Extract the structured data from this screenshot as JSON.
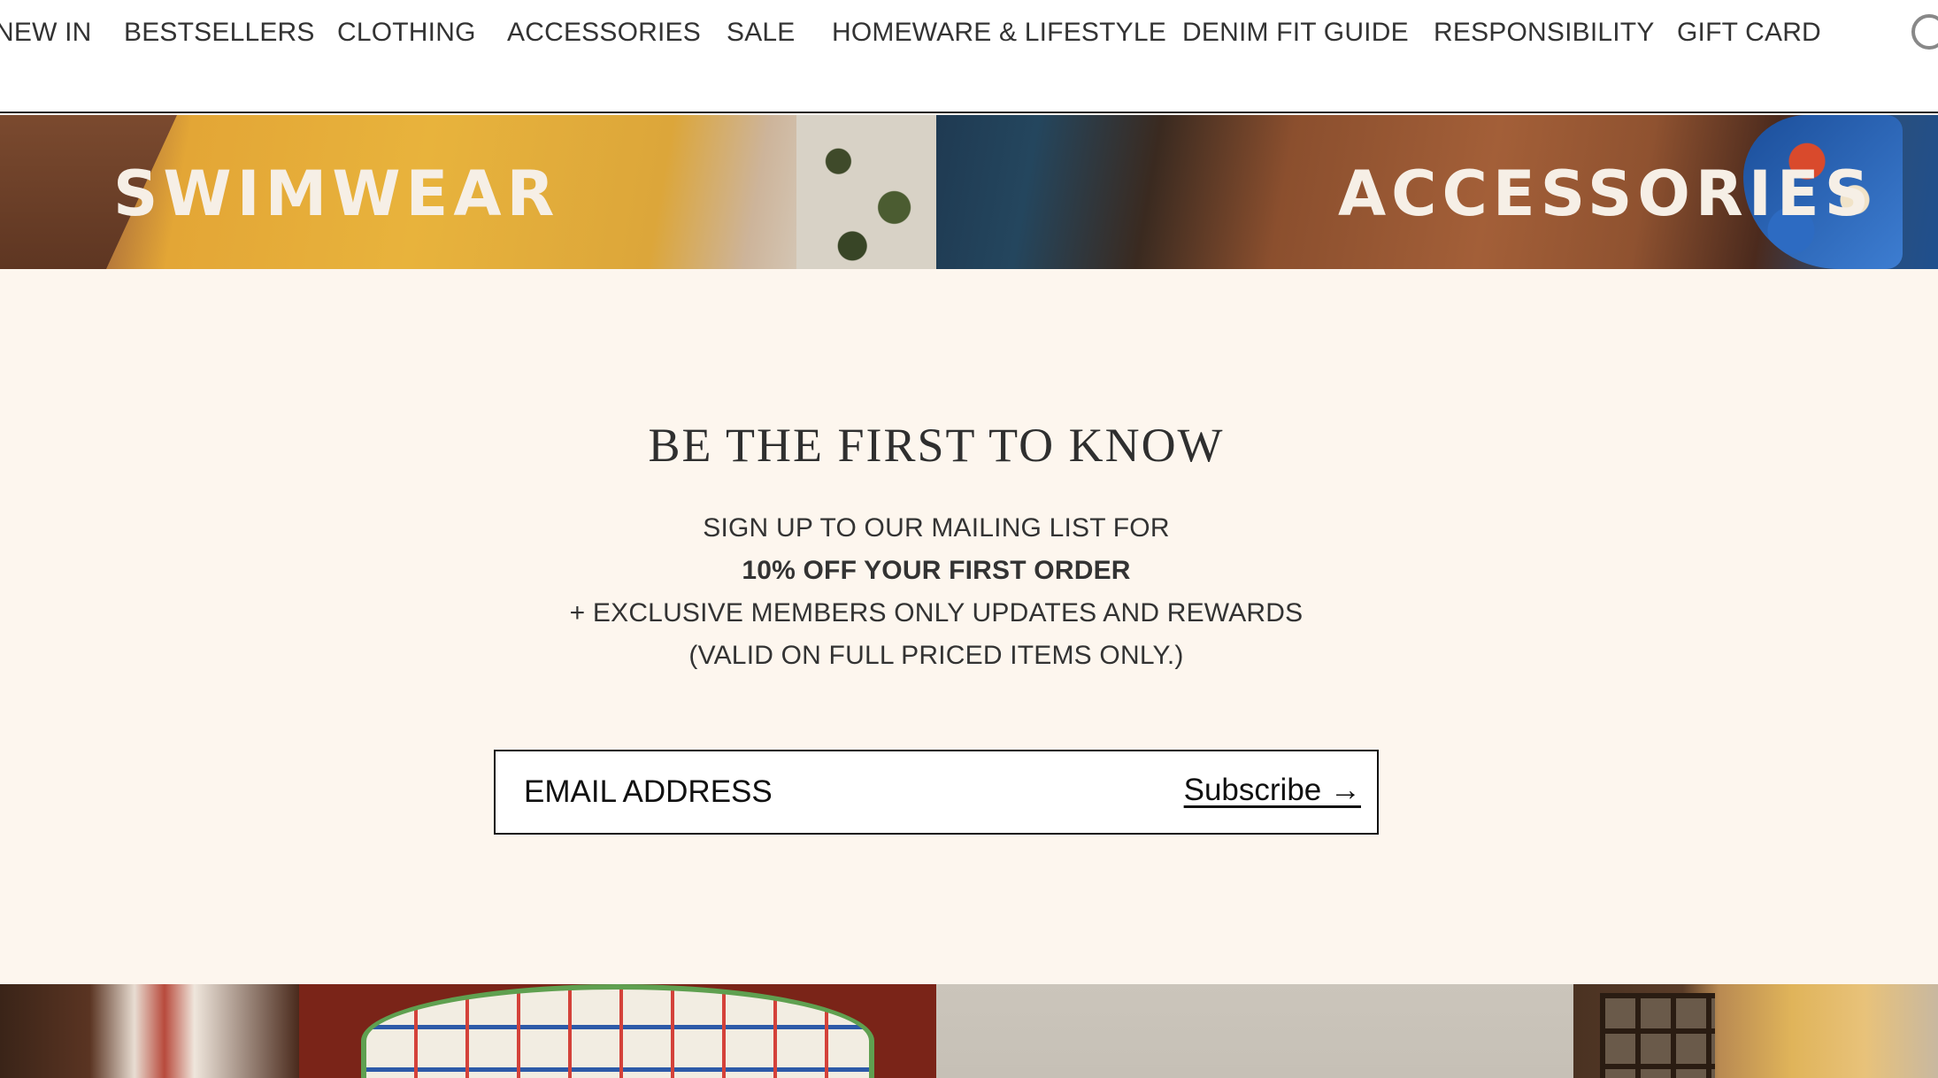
{
  "nav": {
    "items": [
      {
        "label": "NEW IN"
      },
      {
        "label": "BESTSELLERS"
      },
      {
        "label": "CLOTHING"
      },
      {
        "label": "ACCESSORIES"
      },
      {
        "label": "SALE"
      },
      {
        "label": "HOMEWARE & LIFESTYLE"
      },
      {
        "label": "DENIM FIT GUIDE"
      },
      {
        "label": "RESPONSIBILITY"
      },
      {
        "label": "GIFT CARD"
      }
    ],
    "search_icon": "search-icon"
  },
  "banners": [
    {
      "label": "SWIMWEAR"
    },
    {
      "label": "ACCESSORIES"
    }
  ],
  "newsletter": {
    "title": "BE THE FIRST TO KNOW",
    "line1": "SIGN UP TO OUR MAILING LIST FOR",
    "line2": "10% OFF YOUR FIRST ORDER",
    "line3": "+ EXCLUSIVE MEMBERS ONLY UPDATES AND REWARDS",
    "line4": "(VALID ON FULL PRICED ITEMS ONLY.)",
    "email_placeholder": "EMAIL ADDRESS",
    "subscribe_label": "Subscribe →"
  },
  "colors": {
    "background": "#fdf6ee",
    "nav_background": "#ffffff",
    "text": "#333333",
    "border": "#111111"
  }
}
